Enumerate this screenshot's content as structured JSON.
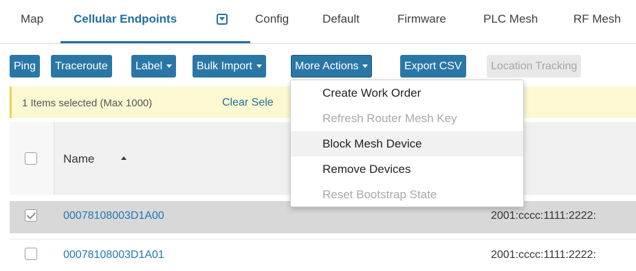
{
  "tabs": [
    {
      "label": "Map"
    },
    {
      "label": "Cellular Endpoints"
    },
    {
      "label": "Config"
    },
    {
      "label": "Default"
    },
    {
      "label": "Firmware"
    },
    {
      "label": "PLC Mesh"
    },
    {
      "label": "RF Mesh"
    }
  ],
  "toolbar": {
    "ping": "Ping",
    "traceroute": "Traceroute",
    "label": "Label",
    "bulk_import": "Bulk Import",
    "more_actions": "More Actions",
    "export_csv": "Export CSV",
    "location_tracking": "Location Tracking"
  },
  "selection": {
    "count_text": "1 Items selected (Max 1000)",
    "clear_text": "Clear Sele"
  },
  "table": {
    "name_header": "Name",
    "rows": [
      {
        "name": "00078108003D1A00",
        "ip": "2001:cccc:1111:2222:",
        "checked": true
      },
      {
        "name": "00078108003D1A01",
        "ip": "2001:cccc:1111:2222:",
        "checked": false
      }
    ]
  },
  "menu": {
    "items": [
      {
        "label": "Create Work Order",
        "enabled": true
      },
      {
        "label": "Refresh Router Mesh Key",
        "enabled": false
      },
      {
        "label": "Block Mesh Device",
        "enabled": true,
        "highlighted": true
      },
      {
        "label": "Remove Devices",
        "enabled": true
      },
      {
        "label": "Reset Bootstrap State",
        "enabled": false
      }
    ]
  },
  "colors": {
    "accent": "#1f6f9f",
    "button": "#2a77a6",
    "selection_bar": "#fcf8d2",
    "selected_row": "#d8d8d8"
  }
}
